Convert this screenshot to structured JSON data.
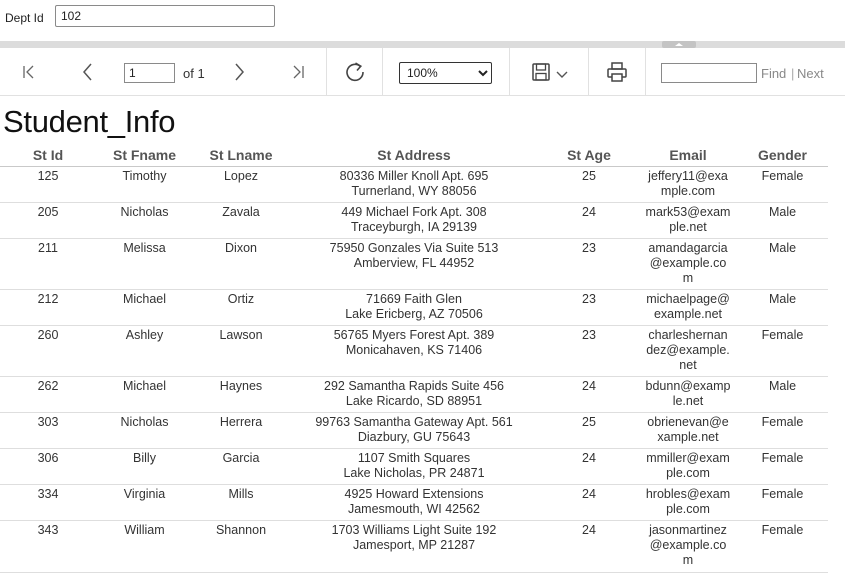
{
  "parameters": {
    "dept_label": "Dept Id",
    "dept_value": "102"
  },
  "toolbar": {
    "page_number": "1",
    "page_of": "of 1",
    "zoom": "100%",
    "zoom_options": [
      "100%"
    ],
    "find_placeholder": "",
    "find_label": "Find",
    "divider": "|",
    "next_label": "Next",
    "icons": {
      "first": "first-page-icon",
      "prev": "previous-page-icon",
      "next": "next-page-icon",
      "last": "last-page-icon",
      "refresh": "refresh-icon",
      "save": "save-icon",
      "save_menu": "chevron-down-icon",
      "print": "print-icon"
    }
  },
  "report": {
    "title": "Student_Info",
    "columns": [
      "St Id",
      "St Fname",
      "St Lname",
      "St Address",
      "St Age",
      "Email",
      "Gender"
    ],
    "rows": [
      {
        "id": "125",
        "fname": "Timothy",
        "lname": "Lopez",
        "addr1": "80336 Miller Knoll Apt. 695",
        "addr2": "Turnerland, WY 88056",
        "age": "25",
        "email": "jeffery11@example.com",
        "gender": "Female"
      },
      {
        "id": "205",
        "fname": "Nicholas",
        "lname": "Zavala",
        "addr1": "449 Michael Fork Apt. 308",
        "addr2": "Traceyburgh, IA 29139",
        "age": "24",
        "email": "mark53@example.net",
        "gender": "Male"
      },
      {
        "id": "211",
        "fname": "Melissa",
        "lname": "Dixon",
        "addr1": "75950 Gonzales Via Suite 513",
        "addr2": "Amberview, FL 44952",
        "age": "23",
        "email": "amandagarcia@example.com",
        "gender": "Male"
      },
      {
        "id": "212",
        "fname": "Michael",
        "lname": "Ortiz",
        "addr1": "71669 Faith Glen",
        "addr2": "Lake Ericberg, AZ 70506",
        "age": "23",
        "email": "michaelpage@example.net",
        "gender": "Male"
      },
      {
        "id": "260",
        "fname": "Ashley",
        "lname": "Lawson",
        "addr1": "56765 Myers Forest Apt. 389",
        "addr2": "Monicahaven, KS 71406",
        "age": "23",
        "email": "charleshernandez@example.net",
        "gender": "Female"
      },
      {
        "id": "262",
        "fname": "Michael",
        "lname": "Haynes",
        "addr1": "292 Samantha Rapids Suite 456",
        "addr2": "Lake Ricardo, SD 88951",
        "age": "24",
        "email": "bdunn@example.net",
        "gender": "Male"
      },
      {
        "id": "303",
        "fname": "Nicholas",
        "lname": "Herrera",
        "addr1": "99763 Samantha Gateway Apt. 561",
        "addr2": "Diazbury, GU 75643",
        "age": "25",
        "email": "obrienevan@example.net",
        "gender": "Female"
      },
      {
        "id": "306",
        "fname": "Billy",
        "lname": "Garcia",
        "addr1": "1107 Smith Squares",
        "addr2": "Lake Nicholas, PR 24871",
        "age": "24",
        "email": "mmiller@example.com",
        "gender": "Female"
      },
      {
        "id": "334",
        "fname": "Virginia",
        "lname": "Mills",
        "addr1": "4925 Howard Extensions",
        "addr2": "Jamesmouth, WI 42562",
        "age": "24",
        "email": "hrobles@example.com",
        "gender": "Female"
      },
      {
        "id": "343",
        "fname": "William",
        "lname": "Shannon",
        "addr1": "1703 Williams Light Suite 192",
        "addr2": "Jamesport, MP 21287",
        "age": "24",
        "email": "jasonmartinez@example.com",
        "gender": "Female"
      }
    ]
  }
}
